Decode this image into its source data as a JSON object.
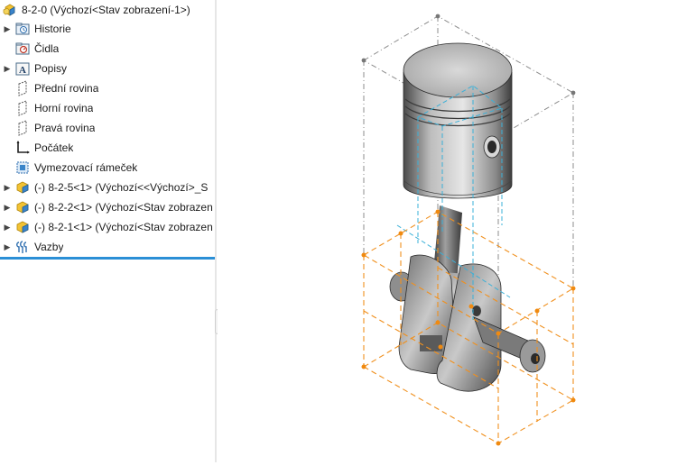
{
  "tree": {
    "root": "8-2-0  (Výchozí<Stav zobrazení-1>)",
    "items": [
      {
        "label": "Historie",
        "icon": "history-folder-icon",
        "expandable": true
      },
      {
        "label": "Čidla",
        "icon": "sensors-icon",
        "expandable": false
      },
      {
        "label": "Popisy",
        "icon": "annotations-icon",
        "expandable": true
      },
      {
        "label": "Přední rovina",
        "icon": "plane-icon",
        "expandable": false
      },
      {
        "label": "Horní rovina",
        "icon": "plane-icon",
        "expandable": false
      },
      {
        "label": "Pravá rovina",
        "icon": "plane-icon",
        "expandable": false
      },
      {
        "label": "Počátek",
        "icon": "origin-icon",
        "expandable": false
      },
      {
        "label": "Vymezovací rámeček",
        "icon": "bounding-box-icon",
        "expandable": false
      },
      {
        "label": "(-) 8-2-5<1>  (Výchozí<<Výchozí>_S",
        "icon": "part-icon",
        "expandable": true
      },
      {
        "label": "(-) 8-2-2<1>  (Výchozí<Stav zobrazen",
        "icon": "part-icon",
        "expandable": true
      },
      {
        "label": "(-) 8-2-1<1>  (Výchozí<Stav zobrazen",
        "icon": "part-icon",
        "expandable": true
      },
      {
        "label": "Vazby",
        "icon": "mates-icon",
        "expandable": true
      }
    ]
  },
  "colors": {
    "selection_line": "#2b8fd6",
    "bounding_box_upper": "#8c8c8c",
    "bounding_box_lower": "#f0901e",
    "axes": "#3ab0d8",
    "part_yellow": "#f2c233",
    "part_blue": "#3a84c9"
  }
}
